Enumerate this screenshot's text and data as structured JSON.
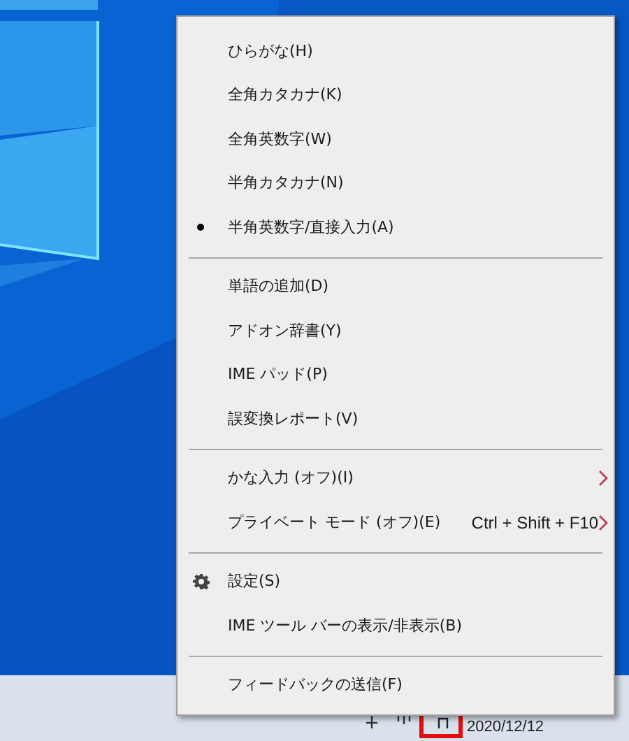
{
  "menu": {
    "sections": [
      [
        {
          "kind": "radio",
          "label": "ひらがな(H)",
          "selected": false
        },
        {
          "kind": "radio",
          "label": "全角カタカナ(K)",
          "selected": false
        },
        {
          "kind": "radio",
          "label": "全角英数字(W)",
          "selected": false
        },
        {
          "kind": "radio",
          "label": "半角カタカナ(N)",
          "selected": false
        },
        {
          "kind": "radio",
          "label": "半角英数字/直接入力(A)",
          "selected": true
        }
      ],
      [
        {
          "kind": "action",
          "label": "単語の追加(D)"
        },
        {
          "kind": "action",
          "label": "アドオン辞書(Y)"
        },
        {
          "kind": "action",
          "label": "IME パッド(P)"
        },
        {
          "kind": "action",
          "label": "誤変換レポート(V)"
        }
      ],
      [
        {
          "kind": "submenu",
          "label": "かな入力 (オフ)(I)"
        },
        {
          "kind": "submenu",
          "label": "プライベート モード (オフ)(E)",
          "shortcut": "Ctrl + Shift + F10"
        }
      ],
      [
        {
          "kind": "settings",
          "label": "設定(S)"
        },
        {
          "kind": "action",
          "label": "IME ツール バーの表示/非表示(B)"
        }
      ],
      [
        {
          "kind": "action",
          "label": "フィードバックの送信(F)"
        }
      ]
    ]
  },
  "taskbar": {
    "ime_indicator": {
      "highlighted": true
    },
    "date": "2020/12/12"
  }
}
